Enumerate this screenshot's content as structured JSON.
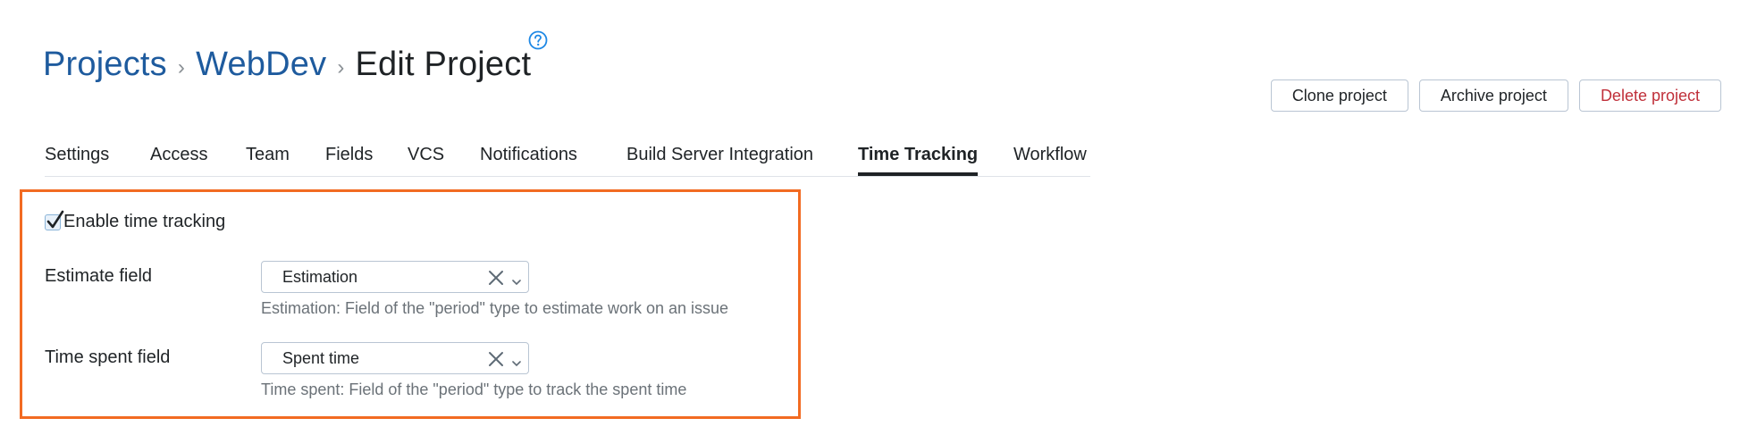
{
  "breadcrumb": {
    "items": [
      "Projects",
      "WebDev"
    ],
    "separator": "›",
    "current": "Edit Project"
  },
  "header": {
    "clone_label": "Clone project",
    "archive_label": "Archive project",
    "delete_label": "Delete project"
  },
  "tabs": [
    {
      "label": "Settings"
    },
    {
      "label": "Access"
    },
    {
      "label": "Team"
    },
    {
      "label": "Fields"
    },
    {
      "label": "VCS"
    },
    {
      "label": "Notifications"
    },
    {
      "label": "Build Server Integration"
    },
    {
      "label": "Time Tracking",
      "active": true
    },
    {
      "label": "Workflow"
    }
  ],
  "time_tracking": {
    "enable_label": "Enable time tracking",
    "enabled": true,
    "estimate": {
      "label": "Estimate field",
      "value": "Estimation",
      "hint": "Estimation: Field of the \"period\" type to estimate work on an issue"
    },
    "spent": {
      "label": "Time spent field",
      "value": "Spent time",
      "hint": "Time spent: Field of the \"period\" type to track the spent time"
    }
  },
  "icons": {
    "help": "help-circle-icon",
    "clear": "clear-x-icon",
    "dropdown": "chevron-down-icon",
    "check": "checkmark-icon"
  },
  "colors": {
    "link": "#1e5b9e",
    "danger": "#c0303a",
    "highlight_border": "#f26b22",
    "help_icon": "#1e88e5",
    "muted": "#6b7278"
  }
}
